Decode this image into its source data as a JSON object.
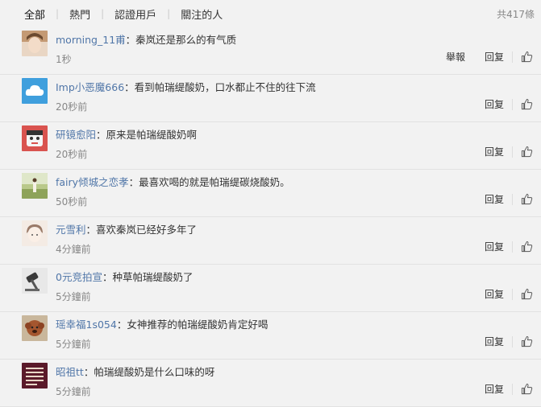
{
  "tabs": [
    {
      "label": "全部",
      "active": true
    },
    {
      "label": "熱門"
    },
    {
      "label": "認證用戶"
    },
    {
      "label": "關注的人"
    }
  ],
  "total": "共417條",
  "labels": {
    "report": "舉報",
    "reply": "回复"
  },
  "comments": [
    {
      "user": "morning_11甫",
      "text": "：秦岚还是那么的有气质",
      "time": "1秒",
      "report": true,
      "avatar": "woman-photo"
    },
    {
      "user": "Imp小恶魔666",
      "text": "：看到帕瑞缇酸奶，口水都止不住的往下流",
      "time": "20秒前",
      "avatar": "cloud-logo"
    },
    {
      "user": "研镜愈阳",
      "text": "：原来是帕瑞缇酸奶啊",
      "time": "20秒前",
      "avatar": "cartoon-face"
    },
    {
      "user": "fairy倾城之恋孝",
      "text": "：最喜欢喝的就是帕瑞缇碳烧酸奶。",
      "time": "50秒前",
      "avatar": "field-photo"
    },
    {
      "user": "元雪利",
      "text": "：喜欢秦岚已经好多年了",
      "time": "4分鐘前",
      "avatar": "girl-sketch"
    },
    {
      "user": "0元竞拍宣",
      "text": "：种草帕瑞缇酸奶了",
      "time": "5分鐘前",
      "avatar": "gavel-photo"
    },
    {
      "user": "瑶幸福1s054",
      "text": "：女神推荐的帕瑞缇酸奶肯定好喝",
      "time": "5分鐘前",
      "avatar": "dog-photo"
    },
    {
      "user": "昭祖tt",
      "text": "：帕瑞缇酸奶是什么口味的呀",
      "time": "5分鐘前",
      "avatar": "text-badge"
    }
  ]
}
